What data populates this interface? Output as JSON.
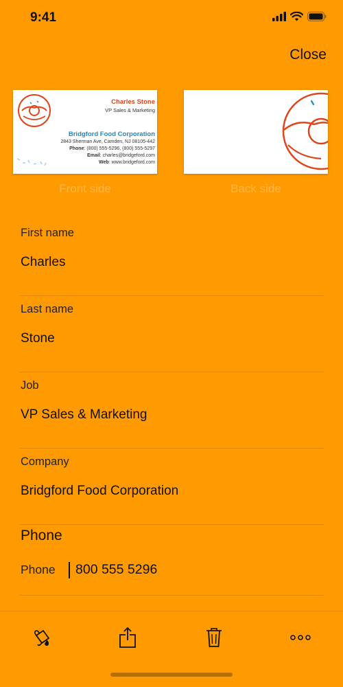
{
  "status_bar": {
    "time": "9:41",
    "icons": [
      "signal-icon",
      "wifi-icon",
      "battery-icon"
    ]
  },
  "header": {
    "close_label": "Close"
  },
  "cards": {
    "front": {
      "caption": "Front side",
      "name": "Charles Stone",
      "title": "VP Sales & Marketing",
      "company": "Bridgford Food Corporation",
      "address": "2843 Sherman Ave, Camden, NJ 08105-442",
      "phone_label": "Phone",
      "phone": ": (800) 555-5296, (800) 555-5297",
      "email_label": "Email",
      "email": ": charles@bridgeford.com",
      "web_label": "Web",
      "web": ": www.bridgeford.com",
      "logo": "donut-logo"
    },
    "back": {
      "caption": "Back side",
      "logo": "donut-logo"
    }
  },
  "form": {
    "fields": [
      {
        "label": "First name",
        "value": "Charles"
      },
      {
        "label": "Last name",
        "value": "Stone"
      },
      {
        "label": "Job",
        "value": "VP Sales & Marketing"
      },
      {
        "label": "Company",
        "value": "Bridgford Food Corporation"
      }
    ],
    "phone": {
      "section_title": "Phone",
      "label": "Phone",
      "value": "800 555 5296"
    }
  },
  "toolbar": {
    "icons": [
      "paint-bucket-icon",
      "share-icon",
      "trash-icon",
      "more-icon"
    ]
  },
  "colors": {
    "background": "#ff9a00",
    "caption": "#ffb64a",
    "card_name": "#e0451a",
    "card_company": "#1e88c9",
    "text": "#111111"
  }
}
